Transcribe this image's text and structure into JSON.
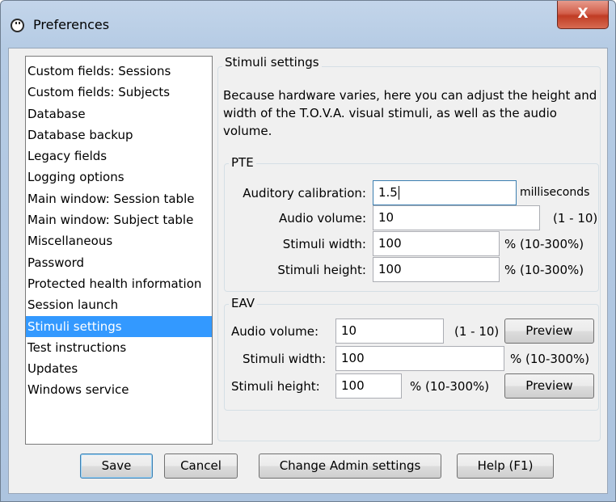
{
  "window": {
    "title": "Preferences",
    "close_label": "X"
  },
  "sidebar": {
    "items": [
      {
        "label": "Custom fields: Sessions"
      },
      {
        "label": "Custom fields: Subjects"
      },
      {
        "label": "Database"
      },
      {
        "label": "Database backup"
      },
      {
        "label": "Legacy fields"
      },
      {
        "label": "Logging options"
      },
      {
        "label": "Main window: Session table"
      },
      {
        "label": "Main window: Subject table"
      },
      {
        "label": "Miscellaneous"
      },
      {
        "label": "Password"
      },
      {
        "label": "Protected health information"
      },
      {
        "label": "Session launch"
      },
      {
        "label": "Stimuli settings"
      },
      {
        "label": "Test instructions"
      },
      {
        "label": "Updates"
      },
      {
        "label": "Windows service"
      }
    ],
    "selected": "Stimuli settings"
  },
  "stimuli": {
    "group_title": "Stimuli settings",
    "description": "Because hardware varies, here you can adjust the height and width of the T.O.V.A. visual stimuli, as well as the audio volume.",
    "pte": {
      "title": "PTE",
      "auditory_calibration_label": "Auditory calibration:",
      "auditory_calibration_value": "1.5",
      "auditory_calibration_unit": "milliseconds",
      "audio_volume_label": "Audio volume:",
      "audio_volume_value": "10",
      "audio_volume_range": "(1 - 10)",
      "stimuli_width_label": "Stimuli width:",
      "stimuli_width_value": "100",
      "stimuli_width_range": "% (10-300%)",
      "stimuli_height_label": "Stimuli height:",
      "stimuli_height_value": "100",
      "stimuli_height_range": "% (10-300%)"
    },
    "eav": {
      "title": "EAV",
      "audio_volume_label": "Audio volume:",
      "audio_volume_value": "10",
      "audio_volume_range": "(1 - 10)",
      "preview_label": "Preview",
      "stimuli_width_label": "Stimuli width:",
      "stimuli_width_value": "100",
      "stimuli_width_range": "% (10-300%)",
      "stimuli_height_label": "Stimuli height:",
      "stimuli_height_value": "100",
      "stimuli_height_range": "% (10-300%)",
      "preview2_label": "Preview"
    }
  },
  "buttons": {
    "save": "Save",
    "cancel": "Cancel",
    "change_admin": "Change Admin settings",
    "help": "Help (F1)"
  },
  "colors": {
    "selection": "#3399ff",
    "close_button": "#c03c24"
  }
}
